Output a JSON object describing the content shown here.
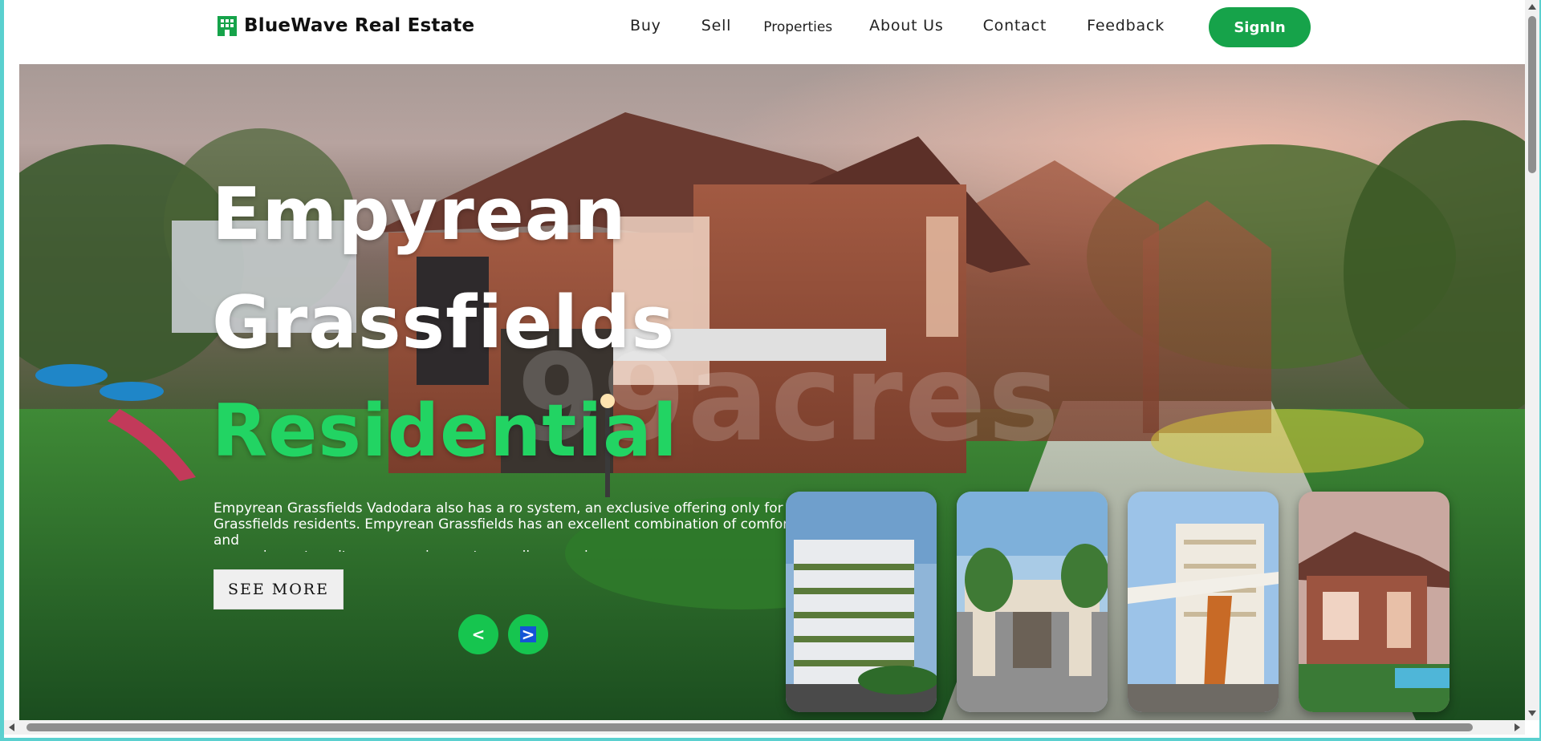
{
  "brand": {
    "name": "BlueWave Real Estate",
    "icon": "building-icon"
  },
  "nav": {
    "items": [
      {
        "label": "Buy"
      },
      {
        "label": "Sell"
      },
      {
        "label": "Properties"
      },
      {
        "label": "About Us"
      },
      {
        "label": "Contact"
      },
      {
        "label": "Feedback"
      }
    ],
    "signin_label": "SignIn"
  },
  "hero": {
    "title_line1": "Empyrean",
    "title_line2": "Grassfields",
    "title_accent": "Residential",
    "description": "Empyrean Grassfields Vadodara also has a ro system, an exclusive offering only for\nGrassfields residents. Empyrean Grassfields has an excellent combination of comfort and\nconvenience to suit every requirement as well as need.",
    "see_more_label": "SEE MORE",
    "prev_label": "<",
    "next_label": ">",
    "watermark": "99acres",
    "thumbnails": [
      {
        "name": "thumbnail-tower-greenery"
      },
      {
        "name": "thumbnail-gated-entrance"
      },
      {
        "name": "thumbnail-apartment-portico"
      },
      {
        "name": "thumbnail-brick-villa"
      }
    ]
  },
  "colors": {
    "accent": "#16a34a",
    "title_accent": "#22d463",
    "arrow_button": "#16c54f",
    "page_border": "#5ad0cf"
  }
}
